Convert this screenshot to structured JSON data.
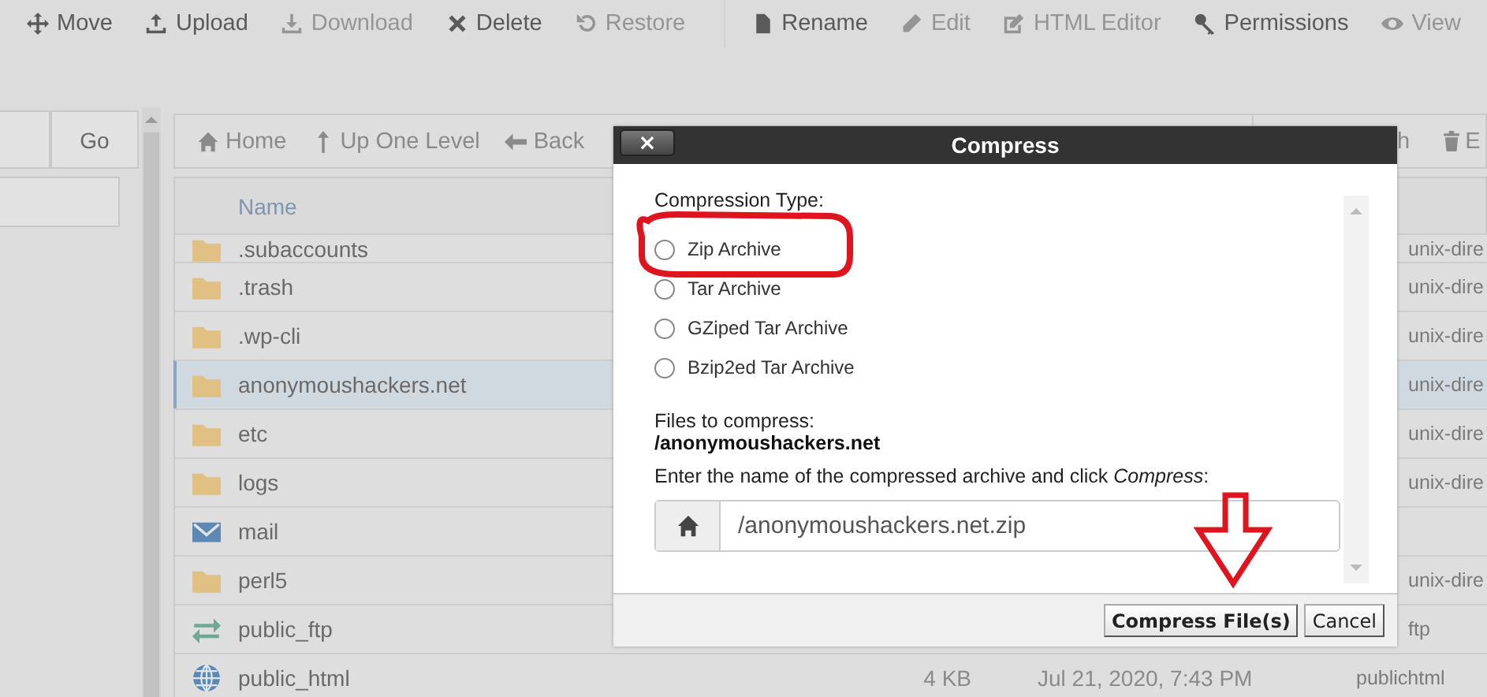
{
  "toolbar": [
    [
      {
        "label": "Move",
        "disabled": false
      },
      {
        "label": "Upload",
        "disabled": false
      },
      {
        "label": "Download",
        "disabled": true
      },
      {
        "label": "Delete",
        "disabled": false
      },
      {
        "label": "Restore",
        "disabled": true
      }
    ],
    [
      {
        "label": "Rename",
        "disabled": false
      },
      {
        "label": "Edit",
        "disabled": true
      },
      {
        "label": "HTML Editor",
        "disabled": true
      },
      {
        "label": "Permissions",
        "disabled": false
      },
      {
        "label": "View",
        "disabled": true
      }
    ]
  ],
  "left_panel": {
    "go_button": "Go"
  },
  "nav": [
    {
      "label": "Home"
    },
    {
      "label": "Up One Level"
    },
    {
      "label": "Back"
    }
  ],
  "nav_right": [
    {
      "label": "h"
    },
    {
      "label": "E"
    }
  ],
  "table": {
    "columns": [
      "Name"
    ],
    "rows": [
      {
        "name": ".subaccounts",
        "kind": "folder",
        "selected": false,
        "type": "unix-dire"
      },
      {
        "name": ".trash",
        "kind": "folder",
        "selected": false,
        "type": "unix-dire"
      },
      {
        "name": ".wp-cli",
        "kind": "folder",
        "selected": false,
        "type": "unix-dire"
      },
      {
        "name": "anonymoushackers.net",
        "kind": "folder",
        "selected": true,
        "type": "unix-dire"
      },
      {
        "name": "etc",
        "kind": "folder",
        "selected": false,
        "type": "unix-dire"
      },
      {
        "name": "logs",
        "kind": "folder",
        "selected": false,
        "type": "unix-dire"
      },
      {
        "name": "mail",
        "kind": "mail",
        "selected": false
      },
      {
        "name": "perl5",
        "kind": "folder",
        "selected": false,
        "type": "unix-dire"
      },
      {
        "name": "public_ftp",
        "kind": "transfer",
        "selected": false,
        "type": "ftp"
      },
      {
        "name": "public_html",
        "kind": "globe",
        "selected": false,
        "size": "4 KB",
        "modified": "Jul 21, 2020, 7:43 PM",
        "type": "publichtml"
      }
    ]
  },
  "dialog": {
    "close": "×",
    "title": "Compress",
    "type_label": "Compression Type:",
    "options": [
      {
        "label": "Zip Archive",
        "selected": false
      },
      {
        "label": "Tar Archive",
        "selected": false
      },
      {
        "label": "GZiped Tar Archive",
        "selected": false
      },
      {
        "label": "Bzip2ed Tar Archive",
        "selected": false
      }
    ],
    "files_label": "Files to compress:",
    "files": "/anonymoushackers.net",
    "prompt": "Enter the name of the compressed archive and click *Compress*:",
    "archive_name": "/anonymoushackers.net.zip",
    "buttons": [
      {
        "label": "Compress File(s)",
        "kind": "primary"
      },
      {
        "label": "Cancel",
        "kind": "secondary"
      }
    ]
  }
}
